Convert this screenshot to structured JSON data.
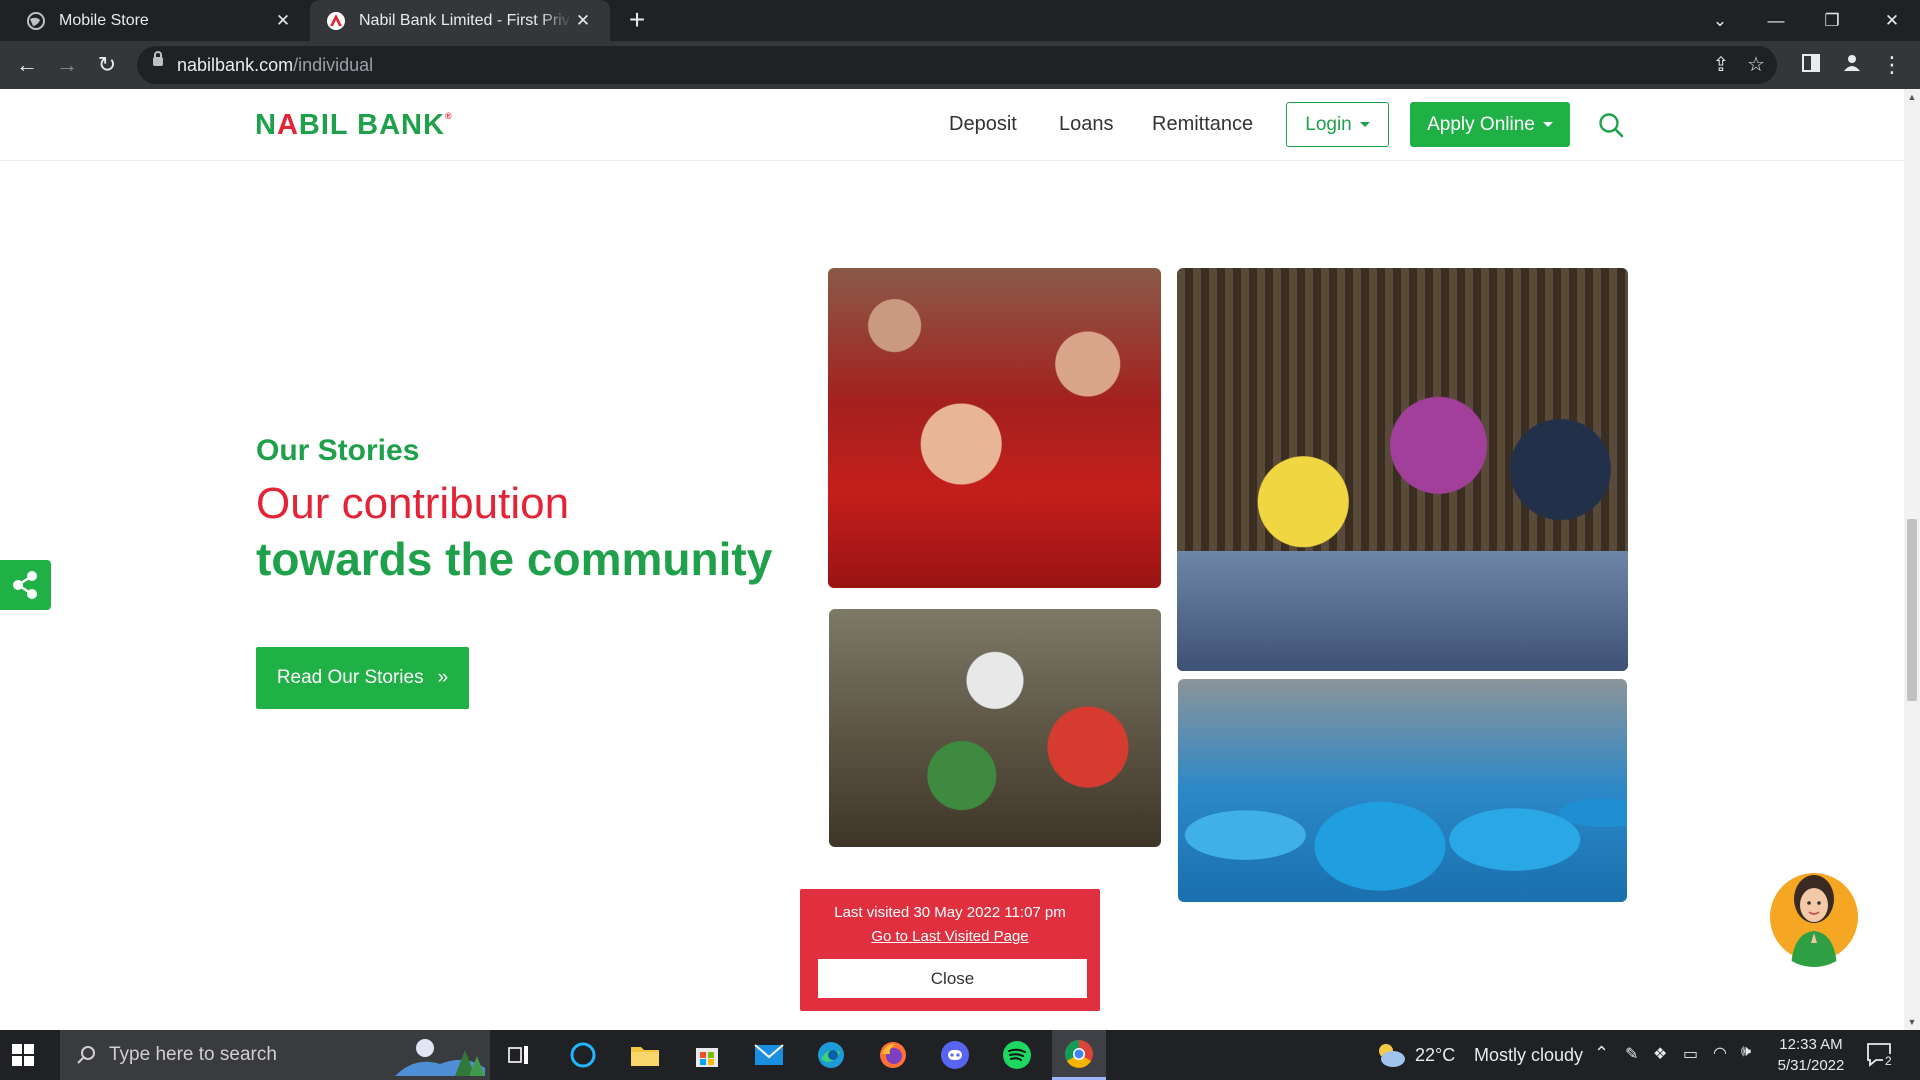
{
  "browser": {
    "tabs": [
      {
        "title": "Mobile Store",
        "active": false
      },
      {
        "title": "Nabil Bank Limited - First Private",
        "active": true
      }
    ],
    "new_tab_symbol": "+",
    "url_host": "nabilbank.com",
    "url_path": "/individual"
  },
  "site": {
    "logo_left": "N",
    "logo_a": "A",
    "logo_right": "BIL BANK",
    "logo_mark": "®",
    "nav": {
      "deposit": "Deposit",
      "loans": "Loans",
      "remittance": "Remittance",
      "login": "Login",
      "apply_online": "Apply Online"
    }
  },
  "stories": {
    "eyebrow": "Our Stories",
    "headline_line1": "Our contribution",
    "headline_line2": "towards the community",
    "button": "Read Our Stories"
  },
  "visit_popup": {
    "message": "Last visited 30 May 2022 11:07 pm",
    "link": "Go to Last Visited Page",
    "close": "Close"
  },
  "taskbar": {
    "search_placeholder": "Type here to search",
    "weather_temp": "22°C",
    "weather_desc": "Mostly cloudy",
    "time": "12:33 AM",
    "date": "5/31/2022",
    "notification_count": "2"
  },
  "colors": {
    "brand_green": "#1fa04a",
    "button_green": "#1fb046",
    "brand_red": "#e32336",
    "popup_red": "#e0303f"
  }
}
